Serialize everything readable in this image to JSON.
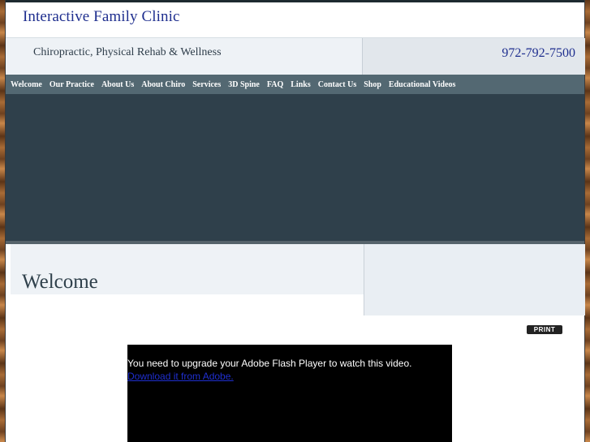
{
  "header": {
    "clinic_name": "Interactive Family Clinic",
    "tagline": "Chiropractic, Physical Rehab & Wellness",
    "phone": "972-792-7500"
  },
  "nav": {
    "items": [
      "Welcome",
      "Our Practice",
      "About Us",
      "About Chiro",
      "Services",
      "3D Spine",
      "FAQ",
      "Links",
      "Contact Us",
      "Shop",
      "Educational Videos"
    ]
  },
  "main": {
    "page_title": "Welcome",
    "print_label": "PRINT",
    "video": {
      "message": "You need to upgrade your Adobe Flash Player to watch this video.",
      "link_text": "Download it from Adobe."
    }
  },
  "colors": {
    "brand_blue": "#1f2f8f",
    "nav_bg": "#536872",
    "hero_bg": "#2f404b"
  }
}
